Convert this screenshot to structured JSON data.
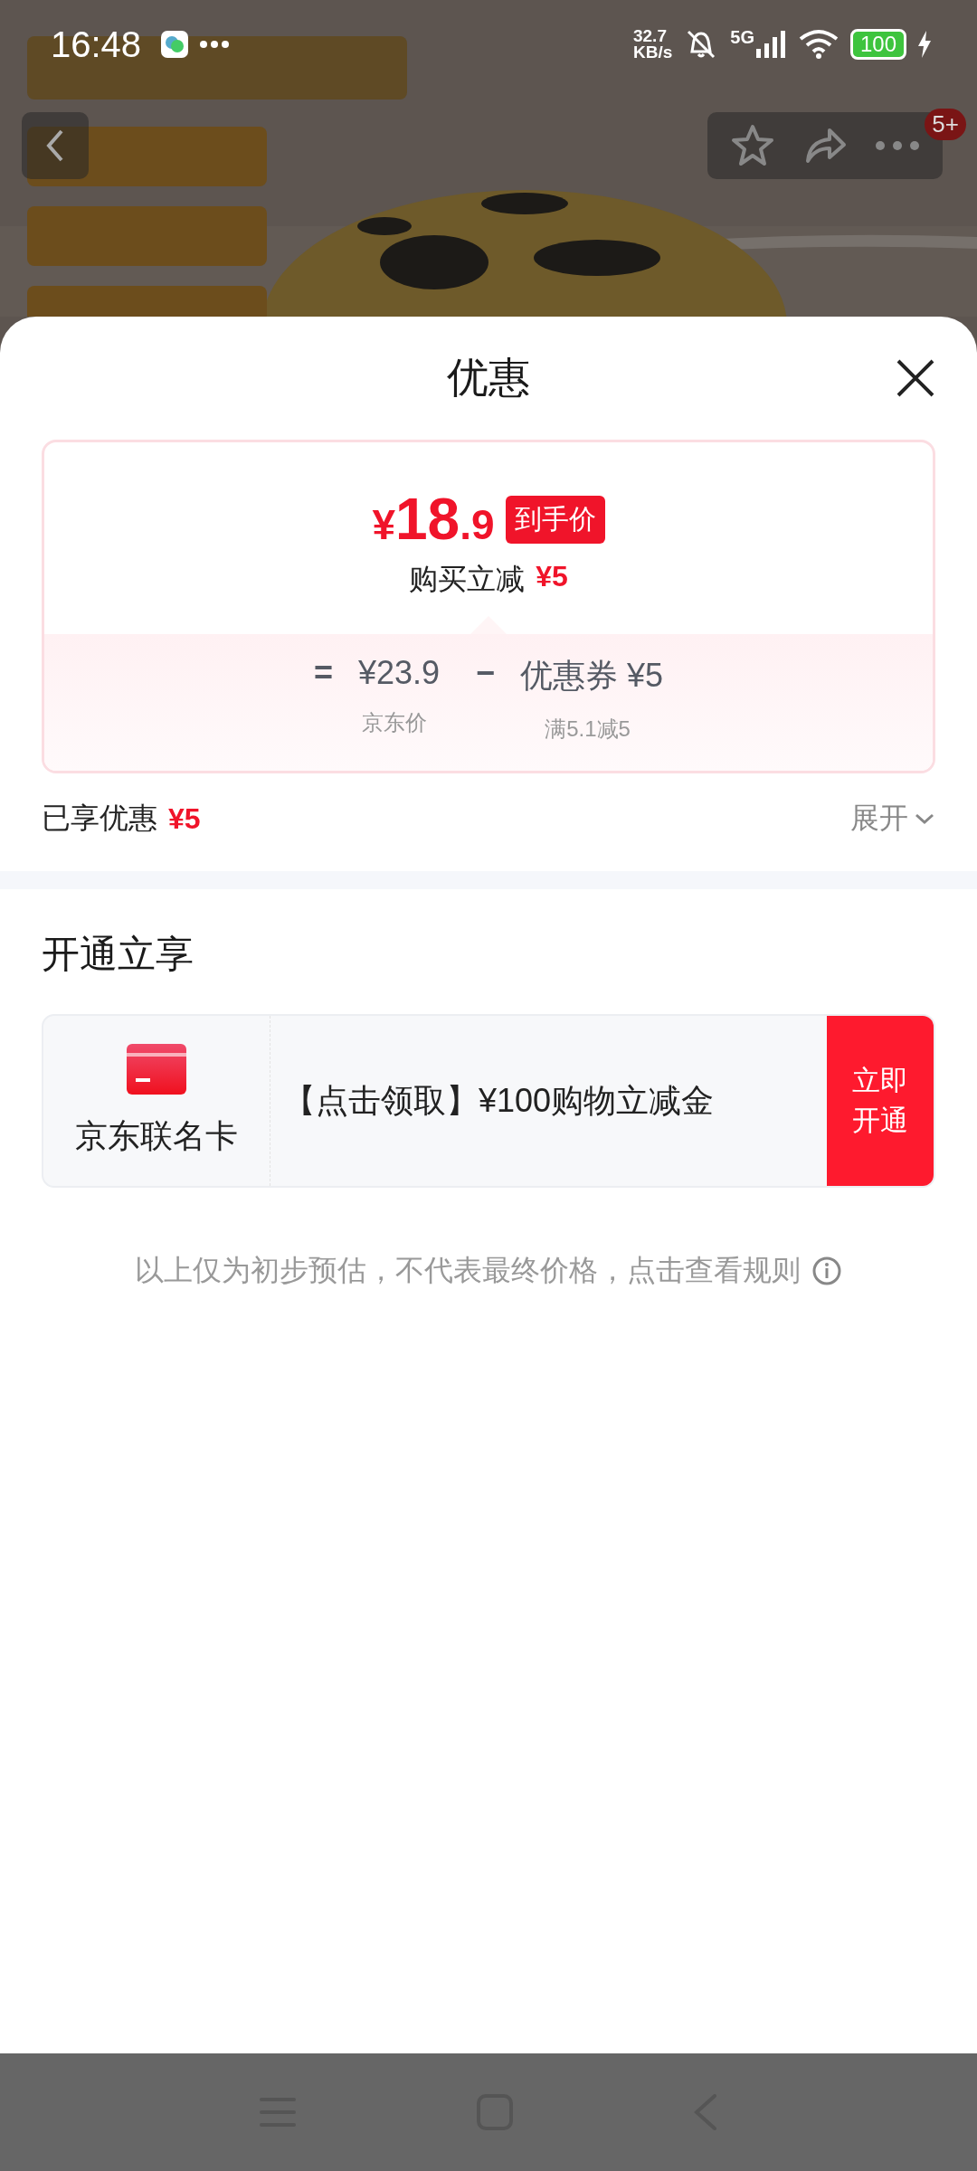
{
  "status_bar": {
    "time": "16:48",
    "net_speed_value": "32.7",
    "net_speed_unit": "KB/s",
    "network": "5G",
    "battery": "100"
  },
  "top_bar": {
    "badge": "5+"
  },
  "sheet": {
    "title": "优惠",
    "price": {
      "currency": "¥",
      "integer": "18",
      "decimal": ".9",
      "tag": "到手价"
    },
    "discount": {
      "label": "购买立减",
      "amount": "¥5"
    },
    "formula": [
      {
        "symbol": "=",
        "value": "¥23.9",
        "label": "京东价"
      },
      {
        "symbol": "−",
        "value": "优惠券 ¥5",
        "label": "满5.1减5"
      }
    ],
    "enjoyed": {
      "label": "已享优惠",
      "amount": "¥5",
      "expand": "展开"
    },
    "section_title": "开通立享",
    "offer": {
      "card_name": "京东联名卡",
      "text": "【点击领取】¥100购物立减金",
      "button": "立即开通"
    },
    "note": "以上仅为初步预估，不代表最终价格，点击查看规则"
  }
}
